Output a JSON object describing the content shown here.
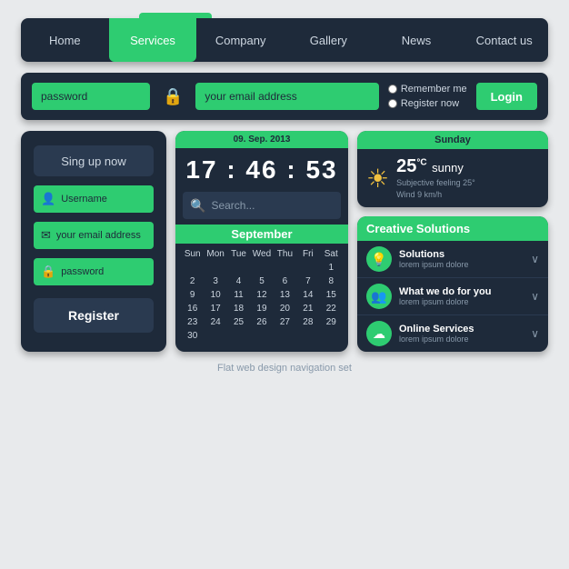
{
  "nav": {
    "items": [
      {
        "label": "Home",
        "active": false
      },
      {
        "label": "Services",
        "active": true
      },
      {
        "label": "Company",
        "active": false
      },
      {
        "label": "Gallery",
        "active": false
      },
      {
        "label": "News",
        "active": false
      },
      {
        "label": "Contact us",
        "active": false
      }
    ]
  },
  "login": {
    "password_placeholder": "password",
    "email_placeholder": "your email address",
    "remember_label": "Remember me",
    "register_label": "Register now",
    "button_label": "Login"
  },
  "signup": {
    "button_label": "Sing up now",
    "username_placeholder": "Username",
    "email_placeholder": "your email address",
    "password_placeholder": "password",
    "register_label": "Register"
  },
  "clock": {
    "date_label": "09. Sep. 2013",
    "time_label": "17 : 46 : 53"
  },
  "search": {
    "placeholder": "Search..."
  },
  "calendar": {
    "month": "September",
    "headers": [
      "Sun",
      "Mon",
      "Tue",
      "Wed",
      "Thu",
      "Fri",
      "Sat"
    ],
    "rows": [
      [
        "",
        "",
        "",
        "",
        "",
        "",
        "1"
      ],
      [
        "2",
        "3",
        "4",
        "5",
        "6",
        "7",
        "8"
      ],
      [
        "9",
        "10",
        "11",
        "12",
        "13",
        "14",
        "15"
      ],
      [
        "16",
        "17",
        "18",
        "19",
        "20",
        "21",
        "22"
      ],
      [
        "23",
        "24",
        "25",
        "26",
        "27",
        "28",
        "29"
      ],
      [
        "30",
        "",
        "",
        "",
        "",
        "",
        ""
      ]
    ]
  },
  "weather": {
    "day_label": "Sunday",
    "temp": "25",
    "unit": "°C",
    "desc": "sunny",
    "feeling": "Subjective feeling  25°",
    "wind": "Wind  9 km/h"
  },
  "solutions": {
    "title": "Creative Solutions",
    "items": [
      {
        "icon": "💡",
        "title": "Solutions",
        "desc": "lorem ipsum dolore"
      },
      {
        "icon": "👥",
        "title": "What we do for you",
        "desc": "lorem ipsum dolore"
      },
      {
        "icon": "☁",
        "title": "Online Services",
        "desc": "lorem ipsum dolore"
      }
    ]
  },
  "footer": {
    "label": "Flat web design navigation set"
  }
}
